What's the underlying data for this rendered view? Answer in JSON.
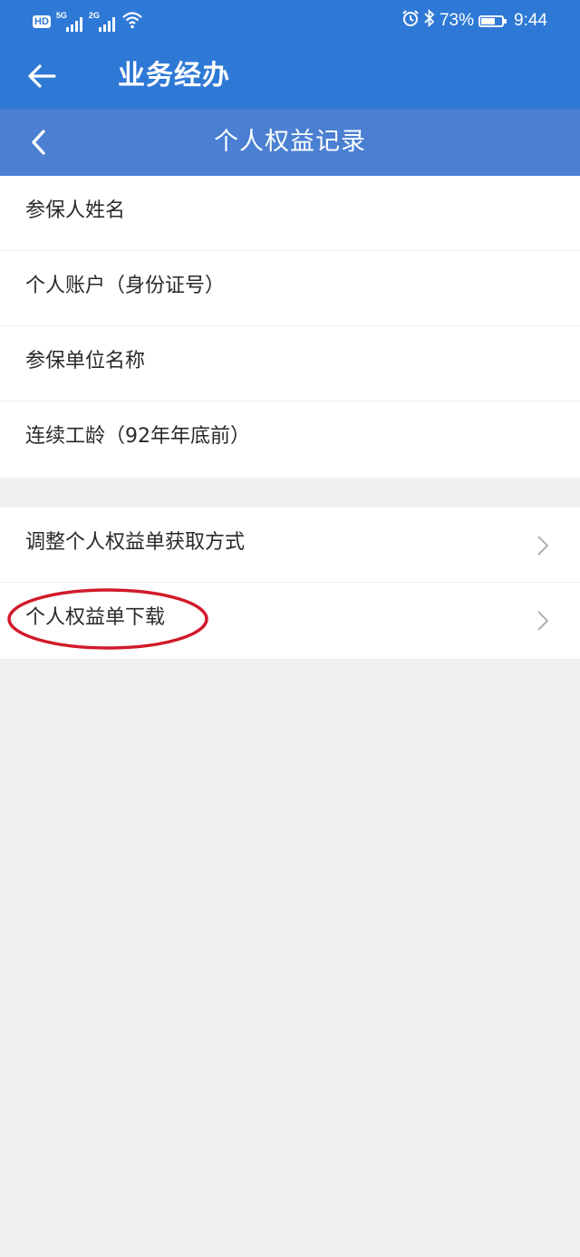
{
  "status_bar": {
    "hd_label": "HD",
    "sim1_label": "5G",
    "sim2_label": "2G",
    "battery_percent_text": "73%",
    "battery_level": 0.73,
    "time": "9:44",
    "icons": [
      "hd-icon",
      "signal-icon",
      "wifi-icon",
      "alarm-icon",
      "bluetooth-icon",
      "battery-icon"
    ]
  },
  "app_header": {
    "title": "业务经办",
    "back_icon": "arrow-left-icon"
  },
  "sub_header": {
    "title": "个人权益记录",
    "back_icon": "chevron-left-icon"
  },
  "info_rows": [
    {
      "label": "参保人姓名",
      "value": ""
    },
    {
      "label": "个人账户（身份证号）",
      "value": ""
    },
    {
      "label": "参保单位名称",
      "value": ""
    },
    {
      "label": "连续工龄（92年年底前）",
      "value": ""
    }
  ],
  "action_rows": [
    {
      "label": "调整个人权益单获取方式",
      "icon": "chevron-right-icon"
    },
    {
      "label": "个人权益单下载",
      "icon": "chevron-right-icon"
    }
  ],
  "colors": {
    "primary": "#2f79d6",
    "sub_header": "#4a7fd2",
    "page_background": "#eef0f2",
    "highlight": "#d11a2a"
  }
}
